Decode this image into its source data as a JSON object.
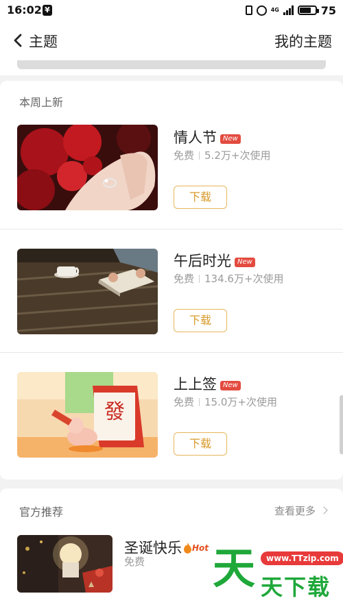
{
  "status_bar": {
    "time": "16:02",
    "yen_icon": "¥",
    "network_label": "4G",
    "battery": "75"
  },
  "nav": {
    "back_icon": "chevron-left-icon",
    "title": "主题",
    "my_themes": "我的主题"
  },
  "weekly": {
    "title": "本周上新",
    "items": [
      {
        "name": "情人节",
        "badge": "New",
        "price": "免费",
        "uses": "5.2万+次使用",
        "download": "下载",
        "thumb": "roses-and-ring"
      },
      {
        "name": "午后时光",
        "badge": "New",
        "price": "免费",
        "uses": "134.6万+次使用",
        "download": "下载",
        "thumb": "coffee-and-book"
      },
      {
        "name": "上上签",
        "badge": "New",
        "price": "免费",
        "uses": "15.0万+次使用",
        "download": "下载",
        "thumb": "fortune-calendar"
      }
    ]
  },
  "official": {
    "title": "官方推荐",
    "see_more": "查看更多",
    "items": [
      {
        "name": "圣诞快乐",
        "badge": "Hot",
        "price": "免费",
        "thumb": "christmas-candle"
      }
    ]
  },
  "watermark": {
    "big_char": "天",
    "url": "www.TTzip.com",
    "text": "天下载"
  },
  "colors": {
    "accent": "#e7b65a",
    "new_badge": "#e34b3f",
    "watermark_green": "#1fa83a"
  }
}
